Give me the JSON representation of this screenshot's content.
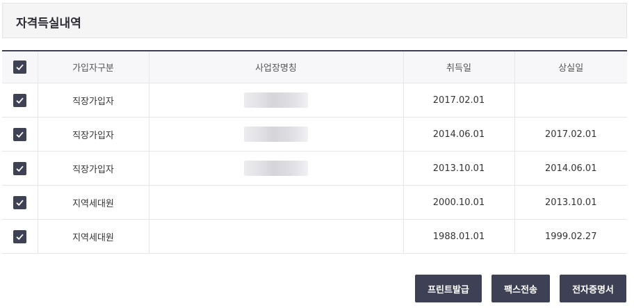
{
  "section": {
    "title": "자격득실내역"
  },
  "table": {
    "columns": [
      "가입자구분",
      "사업장명칭",
      "취득일",
      "상실일"
    ],
    "rows": [
      {
        "type": "직장가입자",
        "workplace": "",
        "acquired": "2017.02.01",
        "lost": ""
      },
      {
        "type": "직장가입자",
        "workplace": "",
        "acquired": "2014.06.01",
        "lost": "2017.02.01"
      },
      {
        "type": "직장가입자",
        "workplace": "",
        "acquired": "2013.10.01",
        "lost": "2014.06.01"
      },
      {
        "type": "지역세대원",
        "workplace": "",
        "acquired": "2000.10.01",
        "lost": "2013.10.01"
      },
      {
        "type": "지역세대원",
        "workplace": "",
        "acquired": "1988.01.01",
        "lost": "1999.02.27"
      }
    ]
  },
  "buttons": {
    "print": "프린트발급",
    "fax": "팩스전송",
    "ecert": "전자증명서"
  },
  "colors": {
    "accent": "#3e4155",
    "header_bg": "#f5f5f6"
  }
}
